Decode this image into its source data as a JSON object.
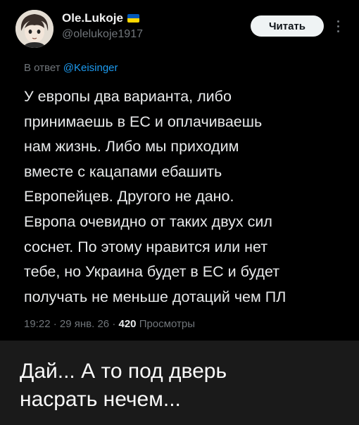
{
  "tweet": {
    "author_name": "Ole.Lukoje",
    "author_handle": "@olelukoje1917",
    "follow_label": "Читать",
    "reply_prefix": "В ответ",
    "reply_mention": "@Keisinger",
    "text": "У европы два варианта, либо\nпринимаешь в ЕС и оплачиваешь\nнам жизнь. Либо мы приходим\nвместе с кацапами ебашить\nЕвропейцев. Другого не дано.\nЕвропа очевидно от таких двух сил\nсоснет. По этому нравится или нет\nтебе, но Украина будет в ЕС и будет\nполучать не меньше дотаций чем ПЛ",
    "time": "19:22",
    "date": "29 янв. 26",
    "views_count": "420",
    "views_label": "Просмотры",
    "flag_colors": [
      "#0057b7",
      "#ffd700"
    ],
    "avatar_icon": "anime-character-avatar",
    "more_icon": "more-vertical-icon"
  },
  "caption": {
    "text": "Дай... А то под дверь\nнасрать нечем..."
  },
  "colors": {
    "background": "#000000",
    "caption_background": "#1a1a1a",
    "mention": "#1d9bf0",
    "muted": "#71767b"
  }
}
